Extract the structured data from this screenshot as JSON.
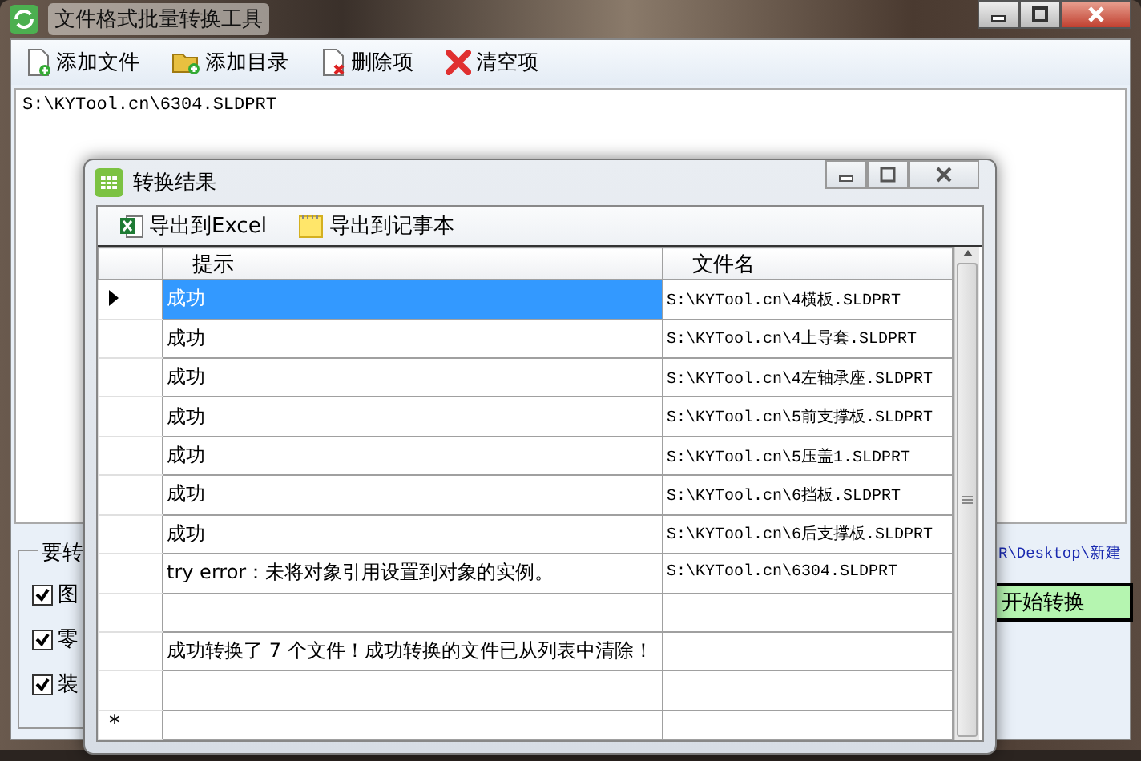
{
  "window": {
    "title": "文件格式批量转换工具"
  },
  "toolbar": [
    {
      "label": "添加文件",
      "kind": "add-file"
    },
    {
      "label": "添加目录",
      "kind": "add-folder"
    },
    {
      "label": "删除项",
      "kind": "delete"
    },
    {
      "label": "清空项",
      "kind": "clear"
    }
  ],
  "file_list": [
    "S:\\KYTool.cn\\6304.SLDPRT"
  ],
  "options_group": {
    "title": "要转",
    "items": [
      {
        "label": "图",
        "checked": true
      },
      {
        "label": "零",
        "checked": true
      },
      {
        "label": "装",
        "checked": true
      }
    ]
  },
  "output_path": "R\\Desktop\\新建",
  "start_button": "开始转换",
  "dialog": {
    "title": "转换结果",
    "toolbar": [
      {
        "label": "导出到Excel",
        "kind": "excel"
      },
      {
        "label": "导出到记事本",
        "kind": "notepad"
      }
    ],
    "columns": [
      "提示",
      "文件名"
    ],
    "rows": [
      {
        "prompt": "成功",
        "file": "S:\\KYTool.cn\\4横板.SLDPRT",
        "current": true,
        "selected": true
      },
      {
        "prompt": "成功",
        "file": "S:\\KYTool.cn\\4上导套.SLDPRT",
        "current": false,
        "selected": false
      },
      {
        "prompt": "成功",
        "file": "S:\\KYTool.cn\\4左轴承座.SLDPRT",
        "current": false,
        "selected": false
      },
      {
        "prompt": "成功",
        "file": "S:\\KYTool.cn\\5前支撑板.SLDPRT",
        "current": false,
        "selected": false
      },
      {
        "prompt": "成功",
        "file": "S:\\KYTool.cn\\5压盖1.SLDPRT",
        "current": false,
        "selected": false
      },
      {
        "prompt": "成功",
        "file": "S:\\KYTool.cn\\6挡板.SLDPRT",
        "current": false,
        "selected": false
      },
      {
        "prompt": "成功",
        "file": "S:\\KYTool.cn\\6后支撑板.SLDPRT",
        "current": false,
        "selected": false
      },
      {
        "prompt": "try error：未将对象引用设置到对象的实例。",
        "file": "S:\\KYTool.cn\\6304.SLDPRT",
        "current": false,
        "selected": false
      },
      {
        "current": false,
        "selected": false
      },
      {
        "prompt": "成功转换了 7 个文件！成功转换的文件已从列表中清除！",
        "current": false,
        "selected": false
      },
      {
        "current": false,
        "selected": false
      }
    ],
    "new_row": {
      "marker": "*"
    }
  }
}
